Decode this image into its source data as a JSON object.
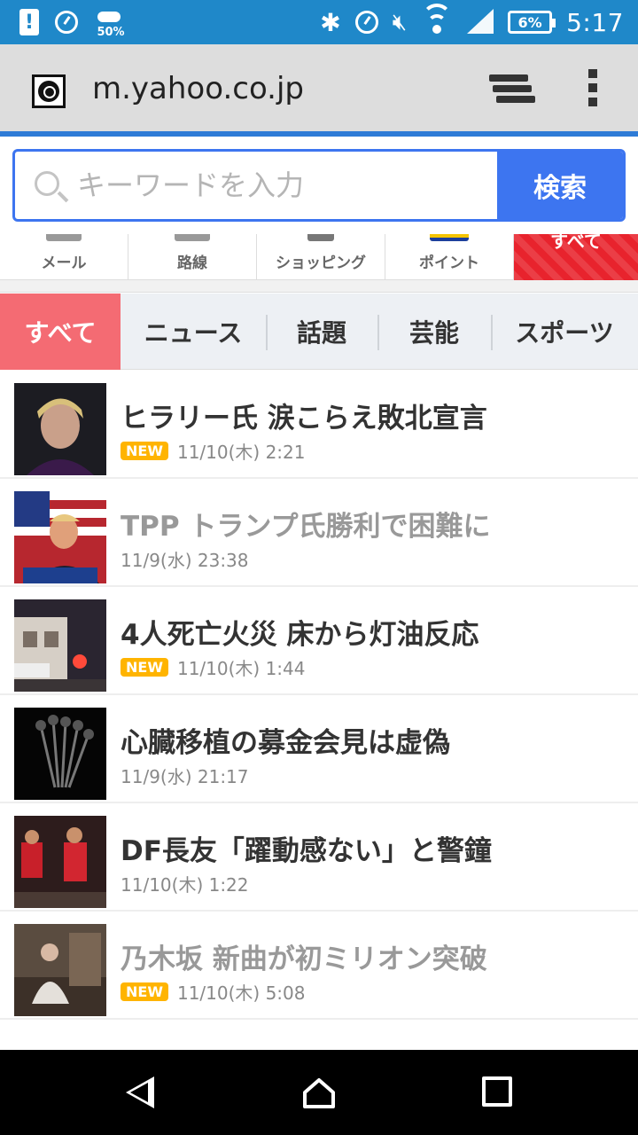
{
  "status_bar": {
    "battery_level": "6%",
    "weather_pct": "50%",
    "time": "5:17",
    "icons": [
      "notification-icon",
      "data-saver-icon",
      "weather-icon",
      "bluetooth-icon",
      "nfc-icon",
      "mute-icon",
      "wifi-icon",
      "signal-icon",
      "battery-icon"
    ]
  },
  "browser": {
    "url": "m.yahoo.co.jp",
    "load_progress": 0.92,
    "accent": "#2e7bd6"
  },
  "search": {
    "placeholder": "キーワードを入力",
    "button_label": "検索"
  },
  "services": [
    {
      "label": "メール"
    },
    {
      "label": "路線"
    },
    {
      "label": "ショッピング"
    },
    {
      "label": "ポイント"
    },
    {
      "label": "すべて"
    }
  ],
  "categories": [
    {
      "label": "すべて",
      "active": true
    },
    {
      "label": "ニュース"
    },
    {
      "label": "話題"
    },
    {
      "label": "芸能"
    },
    {
      "label": "スポーツ"
    }
  ],
  "news": [
    {
      "title": "ヒラリー氏 涙こらえ敗北宣言",
      "date": "11/10(木) 2:21",
      "new": "NEW",
      "read": false,
      "thumb": "person-portrait"
    },
    {
      "title": "TPP トランプ氏勝利で困難に",
      "date": "11/9(水) 23:38",
      "new": "",
      "read": true,
      "thumb": "speaker-with-flags"
    },
    {
      "title": "4人死亡火災 床から灯油反応",
      "date": "11/10(木) 1:44",
      "new": "NEW",
      "read": false,
      "thumb": "night-fire-scene"
    },
    {
      "title": "心臓移植の募金会見は虚偽",
      "date": "11/9(水) 21:17",
      "new": "",
      "read": false,
      "thumb": "microphones"
    },
    {
      "title": "DF長友「躍動感ない」と警鐘",
      "date": "11/10(木) 1:22",
      "new": "",
      "read": false,
      "thumb": "soccer-players"
    },
    {
      "title": "乃木坂 新曲が初ミリオン突破",
      "date": "11/10(木) 5:08",
      "new": "NEW",
      "read": true,
      "thumb": "idol-photo"
    }
  ],
  "colors": {
    "status_bar": "#1f88c9",
    "search_blue": "#3d75f0",
    "active_tab": "#f46b73",
    "new_badge": "#ffb400",
    "red_tile": "#e8232d"
  }
}
